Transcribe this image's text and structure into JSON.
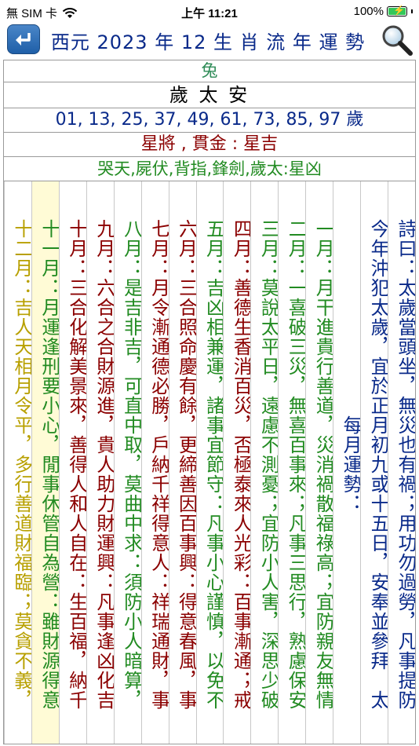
{
  "status_bar": {
    "carrier": "無 SIM 卡",
    "time": "上午 11:21",
    "battery": "100%"
  },
  "header": {
    "title": "西元 2023 年 12 生 肖 流 年 運 勢"
  },
  "info": {
    "animal": "兔",
    "star": "歲 太 安",
    "ages": "01, 13, 25, 37, 49, 61, 73, 85, 97 歲",
    "stars_good": "星將 , 貫金 : 星吉",
    "stars_bad": "哭天,屍伏,背指,鋒劍,歲太:星凶"
  },
  "columns": [
    {
      "text": "詩曰：太歲當頭坐，無災也有禍；用功勿過勞，凡事提防",
      "color": "#0a2a8a",
      "bg": "#ffffff"
    },
    {
      "text": "今年沖犯太歲，宜於正月初九或十五日，安奉並參拜　太",
      "color": "#0a2a8a",
      "bg": "#ffffff"
    },
    {
      "text": "每月運勢：",
      "color": "#0a2a8a",
      "bg": "#ffffff"
    },
    {
      "text": "一月：月干進貴行善道，災消禍散福祿高；宜防親友無情",
      "color": "#228b22",
      "bg": "#ffffff"
    },
    {
      "text": "二月：一喜破三災，無喜百事來；凡事三思行，熟慮保安",
      "color": "#228b22",
      "bg": "#ffffff"
    },
    {
      "text": "三月：莫說太平日，遠慮不測憂；宜防小人害，深思少破",
      "color": "#228b22",
      "bg": "#ffffff"
    },
    {
      "text": "四月：善德生香消百災，否極泰來人光彩：百事漸通；戒",
      "color": "#8b0000",
      "bg": "#ffffff"
    },
    {
      "text": "五月：吉凶相兼運，諸事宜節守：凡事小心謹慎，以免不",
      "color": "#228b22",
      "bg": "#ffffff"
    },
    {
      "text": "六月：三合照命慶有餘，更締善因百事興：得意春風，事",
      "color": "#8b0000",
      "bg": "#ffffff"
    },
    {
      "text": "七月：月令漸通德必勝，戶納千祥得意人：祥瑞通財，事",
      "color": "#8b0000",
      "bg": "#ffffff"
    },
    {
      "text": "八月：是吉非吉，可直中取，莫曲中求：須防小人暗算，",
      "color": "#228b22",
      "bg": "#ffffff"
    },
    {
      "text": "九月：六合之合財源進，貴人助力財運興：凡事逢凶化吉",
      "color": "#8b0000",
      "bg": "#ffffff"
    },
    {
      "text": "十月：三合化解美景來，善得人和人自在：生百福，納千",
      "color": "#8b0000",
      "bg": "#ffffff"
    },
    {
      "text": "十一月：月運逢刑要小心，閒事休管自為營：雖財源得意",
      "color": "#228b22",
      "bg": "#fffbd6"
    },
    {
      "text": "十二月：吉人天相月令平，多行善道財福臨；莫貪不義，",
      "color": "#b8a000",
      "bg": "#ffffff"
    }
  ],
  "colors": {
    "title": "#0a2a8a",
    "border": "#9a9a9a",
    "highlight": "#fffbd6"
  }
}
